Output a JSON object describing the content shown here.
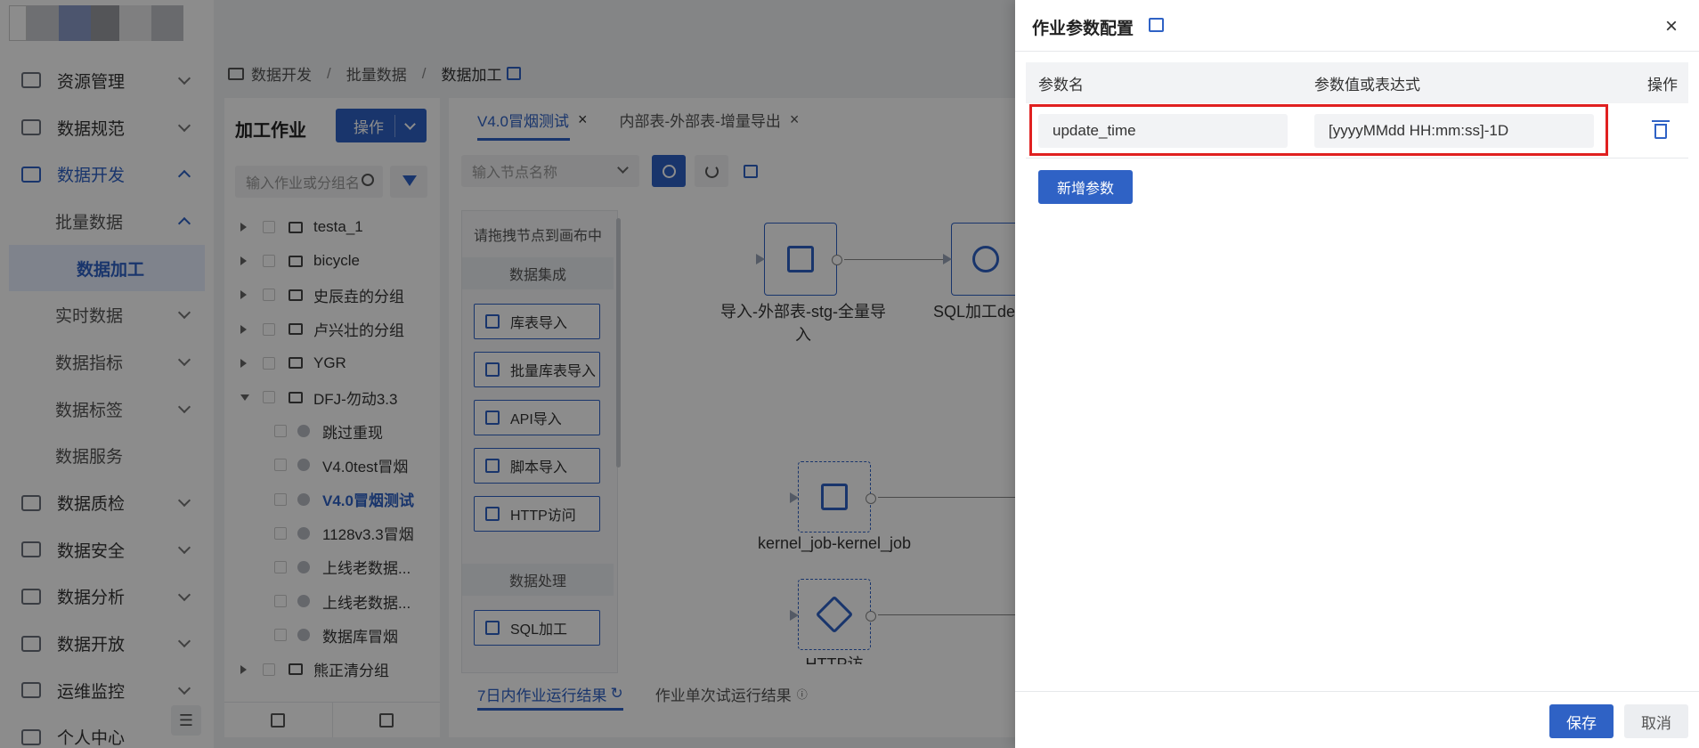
{
  "breadcrumb": {
    "items": [
      "数据开发",
      "批量数据",
      "数据加工"
    ]
  },
  "sidebar": {
    "items": [
      {
        "label": "资源管理"
      },
      {
        "label": "数据规范"
      },
      {
        "label": "数据开发"
      },
      {
        "label": "批量数据"
      },
      {
        "label": "数据加工"
      },
      {
        "label": "实时数据"
      },
      {
        "label": "数据指标"
      },
      {
        "label": "数据标签"
      },
      {
        "label": "数据服务"
      },
      {
        "label": "数据质检"
      },
      {
        "label": "数据安全"
      },
      {
        "label": "数据分析"
      },
      {
        "label": "数据开放"
      },
      {
        "label": "运维监控"
      },
      {
        "label": "个人中心"
      }
    ]
  },
  "job_panel": {
    "title": "加工作业",
    "op_button": "操作",
    "search_placeholder": "输入作业或分组名",
    "tree": [
      {
        "label": "testa_1"
      },
      {
        "label": "bicycle"
      },
      {
        "label": "史辰垚的分组"
      },
      {
        "label": "卢兴壮的分组"
      },
      {
        "label": "YGR"
      },
      {
        "label": "DFJ-勿动3.3"
      },
      {
        "label": "跳过重现"
      },
      {
        "label": "V4.0test冒烟"
      },
      {
        "label": "V4.0冒烟测试"
      },
      {
        "label": "1128v3.3冒烟"
      },
      {
        "label": "上线老数据..."
      },
      {
        "label": "上线老数据..."
      },
      {
        "label": "数据库冒烟"
      },
      {
        "label": "熊正清分组"
      }
    ]
  },
  "canvas": {
    "tabs": [
      {
        "label": "V4.0冒烟测试"
      },
      {
        "label": "内部表-外部表-增量导出"
      }
    ],
    "node_search_placeholder": "输入节点名称",
    "palette": {
      "hint": "请拖拽节点到画布中",
      "section_integration": "数据集成",
      "section_processing": "数据处理",
      "items": [
        "库表导入",
        "批量库表导入",
        "API导入",
        "脚本导入",
        "HTTP访问",
        "SQL加工"
      ]
    },
    "nodes": {
      "node1_label_line1": "导入-外部表-stg-全量导",
      "node1_label_line2": "入",
      "node2_label": "SQL加工de",
      "node3_label": "kernel_job-kernel_job",
      "node4_label": "HTTP访问"
    },
    "bottom_tabs": [
      "7日内作业运行结果",
      "作业单次试运行结果"
    ]
  },
  "drawer": {
    "title": "作业参数配置",
    "close": "×",
    "columns": [
      "参数名",
      "参数值或表达式",
      "操作"
    ],
    "params": [
      {
        "name": "update_time",
        "value": "[yyyyMMdd HH:mm:ss]-1D"
      }
    ],
    "add_button": "新增参数",
    "save_button": "保存",
    "cancel_button": "取消"
  },
  "colors": {
    "accent": "#2f62c5",
    "highlight": "#e02020"
  }
}
